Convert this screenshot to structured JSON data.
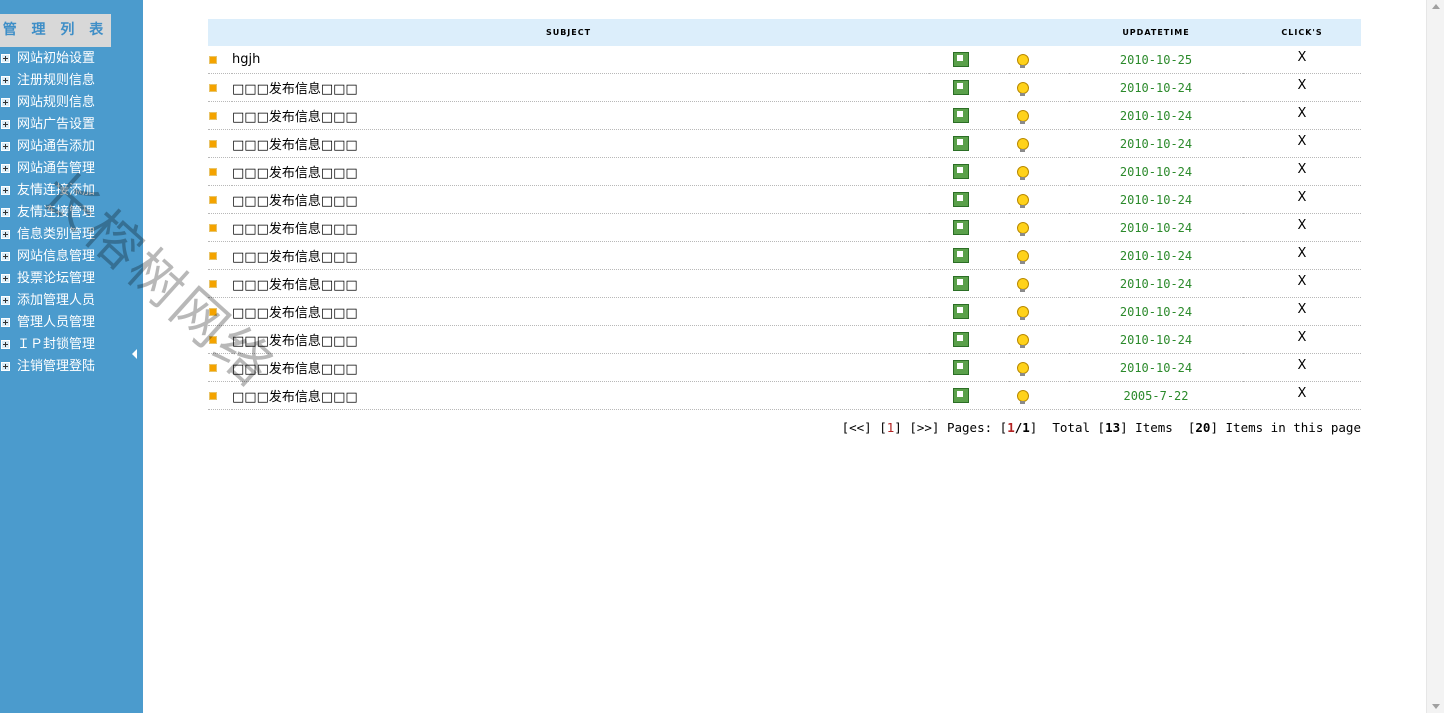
{
  "sidebar": {
    "title": "管 理 列 表",
    "items": [
      {
        "label": "网站初始设置"
      },
      {
        "label": "注册规则信息"
      },
      {
        "label": "网站规则信息"
      },
      {
        "label": "网站广告设置"
      },
      {
        "label": "网站通告添加"
      },
      {
        "label": "网站通告管理"
      },
      {
        "label": "友情连接添加"
      },
      {
        "label": "友情连接管理"
      },
      {
        "label": "信息类别管理"
      },
      {
        "label": "网站信息管理"
      },
      {
        "label": "投票论坛管理"
      },
      {
        "label": "添加管理人员"
      },
      {
        "label": "管理人员管理"
      },
      {
        "label": "ＩＰ封锁管理"
      },
      {
        "label": "注销管理登陆"
      }
    ]
  },
  "table": {
    "headers": {
      "subject": "SUBJECT",
      "updatetime": "UPDATETIME",
      "clicks": "CLICK'S"
    },
    "rows": [
      {
        "subject": "hgjh",
        "date": "2010-10-25",
        "action": "X"
      },
      {
        "subject": "□□□发布信息□□□",
        "date": "2010-10-24",
        "action": "X"
      },
      {
        "subject": "□□□发布信息□□□",
        "date": "2010-10-24",
        "action": "X"
      },
      {
        "subject": "□□□发布信息□□□",
        "date": "2010-10-24",
        "action": "X"
      },
      {
        "subject": "□□□发布信息□□□",
        "date": "2010-10-24",
        "action": "X"
      },
      {
        "subject": "□□□发布信息□□□",
        "date": "2010-10-24",
        "action": "X"
      },
      {
        "subject": "□□□发布信息□□□",
        "date": "2010-10-24",
        "action": "X"
      },
      {
        "subject": "□□□发布信息□□□",
        "date": "2010-10-24",
        "action": "X"
      },
      {
        "subject": "□□□发布信息□□□",
        "date": "2010-10-24",
        "action": "X"
      },
      {
        "subject": "□□□发布信息□□□",
        "date": "2010-10-24",
        "action": "X"
      },
      {
        "subject": "□□□发布信息□□□",
        "date": "2010-10-24",
        "action": "X"
      },
      {
        "subject": "□□□发布信息□□□",
        "date": "2010-10-24",
        "action": "X"
      },
      {
        "subject": "□□□发布信息□□□",
        "date": "2005-7-22",
        "action": "X"
      }
    ]
  },
  "pager": {
    "first": "[<<]",
    "page1_open": "[",
    "page1": "1",
    "page1_close": "]",
    "next": "[>>]",
    "pages_label": "Pages: ",
    "pages_open": "[",
    "pages_current": "1",
    "pages_sep": "/",
    "pages_total": "1",
    "pages_close": "]",
    "total_label": "Total ",
    "total_open": "[",
    "total_count": "13",
    "total_close": "]",
    "items_label": " Items",
    "per_open": "[",
    "per_page": "20",
    "per_close": "]",
    "per_label": " Items in this page"
  },
  "watermark": "长榕树网络",
  "icons": {
    "bullet": "orange-square-bullet-icon",
    "edit": "edit-download-icon",
    "tip": "lightbulb-icon",
    "plus": "plus-box-icon",
    "collapse": "collapse-left-arrow-icon"
  },
  "colors": {
    "sidebar_bg": "#4b9bcd",
    "header_bg": "#dceefb",
    "date_text": "#2b8a2b",
    "page_current": "#b22222"
  }
}
